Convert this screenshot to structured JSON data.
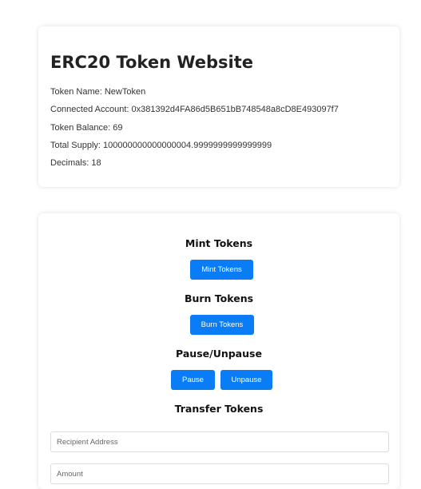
{
  "info": {
    "title": "ERC20 Token Website",
    "token_name": "Token Name: NewToken",
    "connected_account": "Connected Account: 0x381392d4FA86d5B651bB748548a8cD8E493097f7",
    "token_balance": "Token Balance: 69",
    "total_supply": "Total Supply: 100000000000000004.9999999999999999",
    "decimals": "Decimals: 18"
  },
  "mint": {
    "title": "Mint Tokens",
    "button_label": "Mint Tokens"
  },
  "burn": {
    "title": "Burn Tokens",
    "button_label": "Burn Tokens"
  },
  "pause": {
    "title": "Pause/Unpause",
    "pause_label": "Pause",
    "unpause_label": "Unpause"
  },
  "transfer": {
    "title": "Transfer Tokens",
    "recipient_placeholder": "Recipient Address",
    "amount_placeholder": "Amount"
  },
  "colors": {
    "button": "#0a7cf5",
    "button_text": "#ffffff"
  }
}
